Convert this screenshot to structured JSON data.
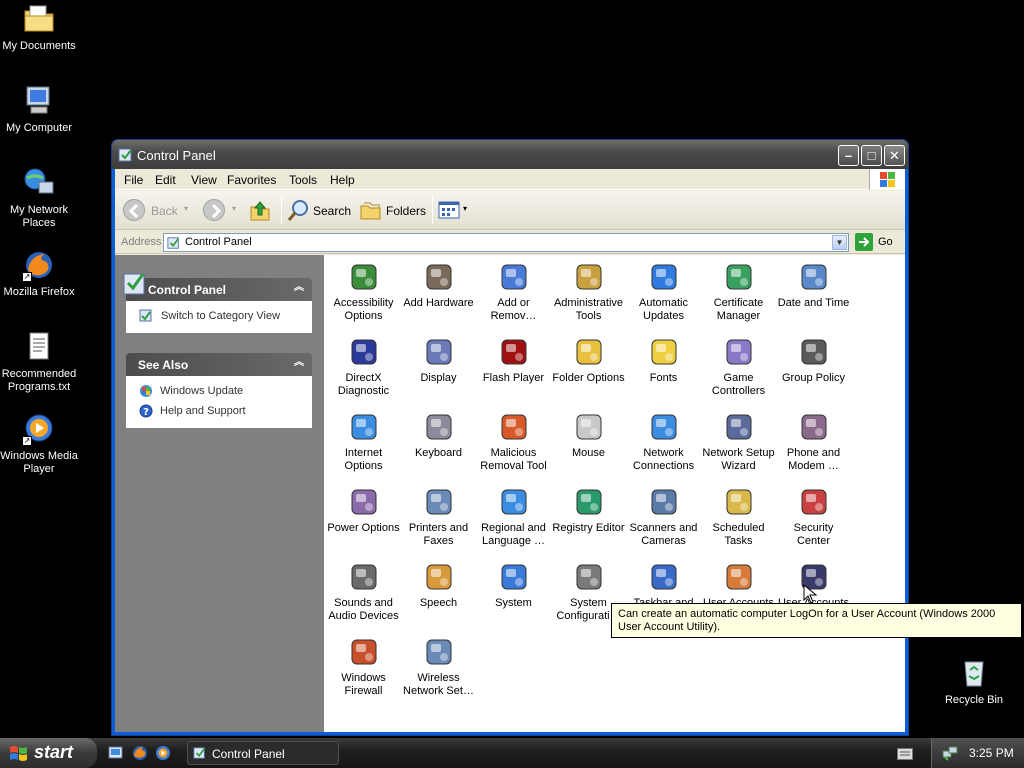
{
  "desktop": {
    "icons": [
      {
        "label": "My Documents",
        "icon": "folder-icon"
      },
      {
        "label": "My Computer",
        "icon": "computer-icon"
      },
      {
        "label": "My Network Places",
        "icon": "network-places-icon"
      },
      {
        "label": "Mozilla Firefox",
        "icon": "firefox-icon"
      },
      {
        "label": "Recommended Programs.txt",
        "icon": "text-file-icon"
      },
      {
        "label": "Windows Media Player",
        "icon": "media-player-icon"
      }
    ],
    "recycle_bin": "Recycle Bin"
  },
  "window": {
    "title": "Control Panel",
    "menu": [
      "File",
      "Edit",
      "View",
      "Favorites",
      "Tools",
      "Help"
    ],
    "toolbar": {
      "back": "Back",
      "search": "Search",
      "folders": "Folders"
    },
    "address": {
      "label": "Address",
      "value": "Control Panel",
      "go": "Go"
    },
    "left_pane": {
      "control_panel_header": "Control Panel",
      "switch_view": "Switch to Category View",
      "see_also_header": "See Also",
      "see_also": [
        "Windows Update",
        "Help and Support"
      ]
    },
    "items": [
      [
        "Accessibility",
        "Options"
      ],
      [
        "Add Hardware",
        ""
      ],
      [
        "Add or",
        "Remov…"
      ],
      [
        "Administrative",
        "Tools"
      ],
      [
        "Automatic",
        "Updates"
      ],
      [
        "Certificate",
        "Manager"
      ],
      [
        "Date and Time",
        ""
      ],
      [
        "DirectX",
        "Diagnostic"
      ],
      [
        "Display",
        ""
      ],
      [
        "Flash Player",
        ""
      ],
      [
        "Folder Options",
        ""
      ],
      [
        "Fonts",
        ""
      ],
      [
        "Game",
        "Controllers"
      ],
      [
        "Group Policy",
        ""
      ],
      [
        "Internet",
        "Options"
      ],
      [
        "Keyboard",
        ""
      ],
      [
        "Malicious",
        "Removal Tool"
      ],
      [
        "Mouse",
        ""
      ],
      [
        "Network",
        "Connections"
      ],
      [
        "Network Setup",
        "Wizard"
      ],
      [
        "Phone and",
        "Modem …"
      ],
      [
        "Power Options",
        ""
      ],
      [
        "Printers and",
        "Faxes"
      ],
      [
        "Regional and",
        "Language …"
      ],
      [
        "Registry Editor",
        ""
      ],
      [
        "Scanners and",
        "Cameras"
      ],
      [
        "Scheduled",
        "Tasks"
      ],
      [
        "Security",
        "Center"
      ],
      [
        "Sounds and",
        "Audio Devices"
      ],
      [
        "Speech",
        ""
      ],
      [
        "System",
        ""
      ],
      [
        "System",
        "Configurati…"
      ],
      [
        "Taskbar and",
        ""
      ],
      [
        "User Accounts",
        ""
      ],
      [
        "User Accounts",
        ""
      ],
      [
        "Windows",
        "Firewall"
      ],
      [
        "Wireless",
        "Network Set…"
      ]
    ],
    "tooltip": "Can create an automatic computer LogOn for a User Account (Windows 2000 User Account Utility)."
  },
  "taskbar": {
    "start": "start",
    "task": "Control Panel",
    "clock": "3:25 PM"
  },
  "colors": {
    "titlebar": "#4a4a4a",
    "pane": "#808080",
    "tooltip": "#ffffe1"
  }
}
